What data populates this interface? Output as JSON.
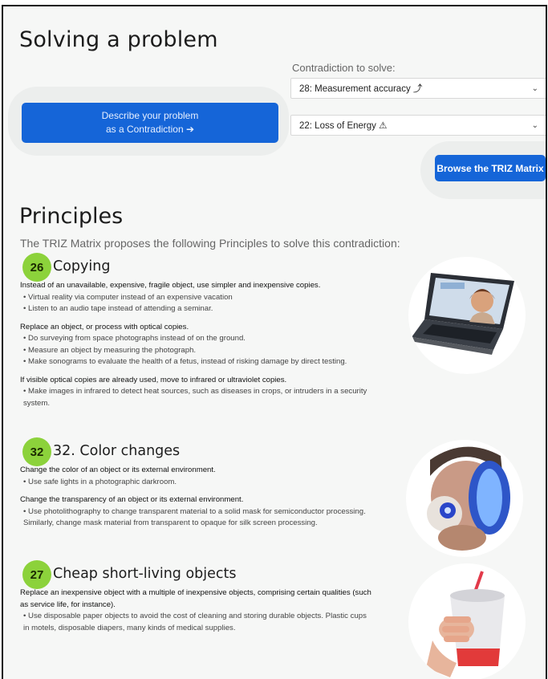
{
  "page_title": "Solving a problem",
  "describe_button": {
    "line1": "Describe your problem",
    "line2": "as a Contradiction ➔"
  },
  "contradiction": {
    "label": "Contradiction to solve:",
    "improving": "28: Measurement accuracy ⤴",
    "worsening": "22: Loss of Energy ⚠"
  },
  "browse_button": "Browse the TRIZ Matrix",
  "principles": {
    "heading": "Principles",
    "subtitle": "The TRIZ Matrix proposes the following Principles to solve this contradiction:",
    "items": [
      {
        "number": "26",
        "title": "Copying",
        "blocks": [
          {
            "head": "Instead of an unavailable, expensive, fragile object, use simpler and inexpensive copies.",
            "bullets": [
              "• Virtual reality via computer instead of an expensive vacation",
              "• Listen to an audio tape instead of attending a seminar."
            ]
          },
          {
            "head": "Replace an object, or process with optical copies.",
            "bullets": [
              "• Do surveying from space photographs instead of on the ground.",
              "• Measure an object by measuring the photograph.",
              "• Make sonograms to evaluate the health of a fetus, instead of risking damage by direct testing."
            ]
          },
          {
            "head": "If visible optical copies are already used, move to infrared or ultraviolet copies.",
            "bullets": [
              "• Make images in infrared to detect heat sources, such as diseases in crops, or intruders in a security system."
            ]
          }
        ]
      },
      {
        "number": "32",
        "title": "32. Color changes",
        "blocks": [
          {
            "head": "Change the color of an object or its external environment.",
            "bullets": [
              "• Use safe lights in a photographic darkroom."
            ]
          },
          {
            "head": "Change the transparency of an object or its external environment.",
            "bullets": [
              "• Use photolithography to change transparent material to a solid mask for semiconductor processing. Similarly, change mask material from transparent to opaque for silk screen processing."
            ]
          }
        ]
      },
      {
        "number": "27",
        "title": "Cheap short-living objects",
        "blocks": [
          {
            "head": "Replace an inexpensive object with a multiple of inexpensive objects, comprising certain qualities (such as service life, for instance).",
            "bullets": [
              "• Use disposable paper objects to avoid the cost of cleaning and storing durable objects. Plastic cups in motels, disposable diapers, many kinds of medical supplies."
            ]
          }
        ]
      }
    ]
  },
  "colors": {
    "primary_button": "#1565d8",
    "badge_green": "#8cd23b",
    "background": "#f6f7f6"
  }
}
